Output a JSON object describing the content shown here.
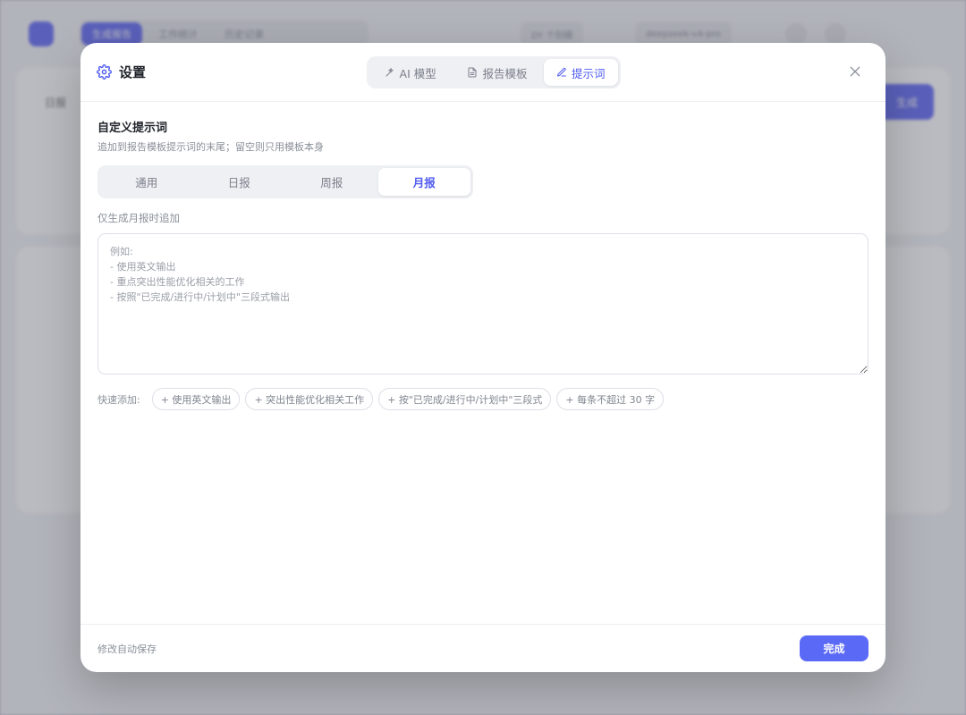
{
  "background": {
    "tabs": [
      "生成报告",
      "工作统计",
      "历史记录"
    ],
    "pills": [
      "DY 个别模",
      "deepseek-v4-pro"
    ],
    "card_title": "日报",
    "generate_label": "生成"
  },
  "modal": {
    "title": "设置",
    "tabs": [
      {
        "label": "AI 模型",
        "icon": "sparkle-icon"
      },
      {
        "label": "报告模板",
        "icon": "document-icon"
      },
      {
        "label": "提示词",
        "icon": "pencil-icon"
      }
    ],
    "active_tab": 2
  },
  "prompt_settings": {
    "title": "自定义提示词",
    "subtitle": "追加到报告模板提示词的末尾；留空则只用模板本身",
    "period_tabs": [
      "通用",
      "日报",
      "周报",
      "月报"
    ],
    "active_period": 3,
    "hint": "仅生成月报时追加",
    "textarea_value": "",
    "textarea_placeholder": "例如:\n- 使用英文输出\n- 重点突出性能优化相关的工作\n- 按照\"已完成/进行中/计划中\"三段式输出",
    "quick_add_label": "快速添加:",
    "quick_chips": [
      "+ 使用英文输出",
      "+ 突出性能优化相关工作",
      "+ 按\"已完成/进行中/计划中\"三段式",
      "+ 每条不超过 30 字"
    ]
  },
  "footer": {
    "autosave_text": "修改自动保存",
    "done_label": "完成"
  },
  "colors": {
    "accent": "#5b6af6",
    "active_text": "#4f5bef"
  }
}
